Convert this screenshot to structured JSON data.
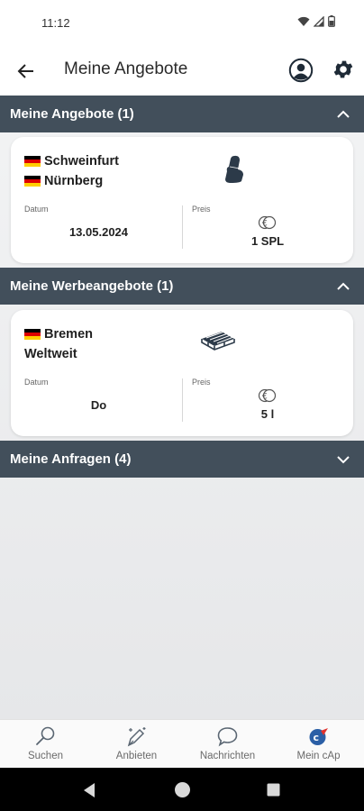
{
  "status": {
    "time": "11:12"
  },
  "header": {
    "title": "Meine Angebote"
  },
  "sections": [
    {
      "title": "Meine Angebote (1)",
      "expanded": true,
      "card": {
        "route": [
          {
            "flag": "DE",
            "city": "Schweinfurt"
          },
          {
            "flag": "DE",
            "city": "Nürnberg"
          }
        ],
        "icon": "car-seat-icon",
        "date_label": "Datum",
        "date_value": "13.05.2024",
        "price_label": "Preis",
        "price_icon": "coins-icon",
        "price_value": "1 SPL"
      }
    },
    {
      "title": "Meine Werbeangebote (1)",
      "expanded": true,
      "card": {
        "route": [
          {
            "flag": "DE",
            "city": "Bremen"
          },
          {
            "flag": "",
            "city": "Weltweit"
          }
        ],
        "icon": "pallet-icon",
        "date_label": "Datum",
        "date_value": "Do",
        "price_label": "Preis",
        "price_icon": "coins-icon",
        "price_value": "5 l"
      }
    },
    {
      "title": "Meine Anfragen (4)",
      "expanded": false
    }
  ],
  "bottom_nav": [
    {
      "label": "Suchen",
      "icon": "search-icon"
    },
    {
      "label": "Anbieten",
      "icon": "pen-sparkle-icon"
    },
    {
      "label": "Nachrichten",
      "icon": "chat-bubble-icon"
    },
    {
      "label": "Mein cAp",
      "icon": "cap-logo-icon"
    }
  ],
  "colors": {
    "section_header": "#424f5b",
    "accent": "#2b5fa6",
    "logo_red": "#e0322e"
  }
}
